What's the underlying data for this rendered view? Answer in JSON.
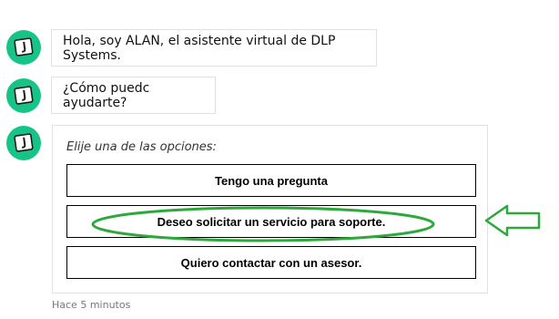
{
  "chat": {
    "messages": [
      {
        "text": "Hola, soy ALAN, el asistente virtual de DLP Systems."
      },
      {
        "text": "¿Cómo puedc ayudarte?"
      }
    ],
    "card": {
      "prompt": "Elije una de las opciones:",
      "options": [
        {
          "label": "Tengo una pregunta"
        },
        {
          "label": "Deseo solicitar un servicio para soporte."
        },
        {
          "label": "Quiero contactar con un asesor."
        }
      ]
    },
    "timestamp": "Hace 5 minutos"
  },
  "colors": {
    "avatar_bg": "#17c488",
    "annotation": "#2ea83a"
  },
  "icons": {
    "avatar": "robot-face-icon",
    "annotation_arrow": "left-arrow-icon",
    "annotation_highlight": "ellipse-highlight"
  }
}
